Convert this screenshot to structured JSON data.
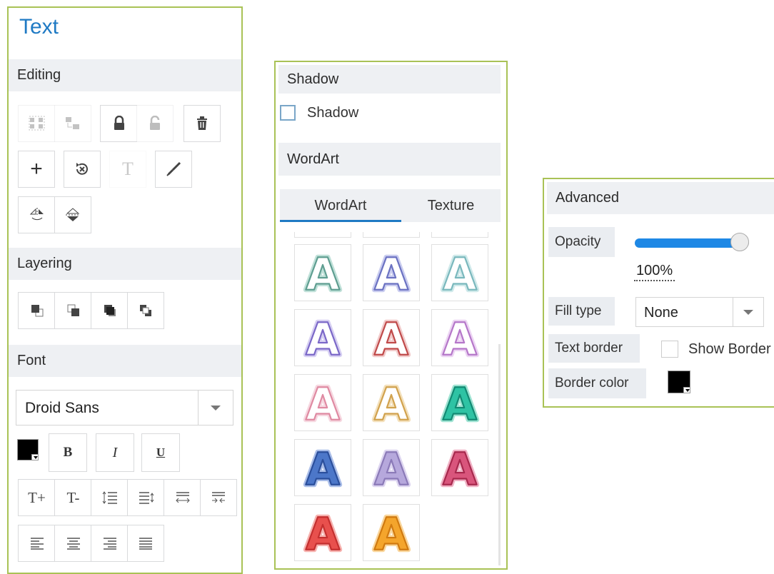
{
  "text_panel": {
    "title": "Text",
    "editing_label": "Editing",
    "layering_label": "Layering",
    "font_label": "Font",
    "font_family": "Droid Sans",
    "bold_label": "B",
    "italic_label": "I",
    "underline_label": "U",
    "increase_size_label": "T+",
    "decrease_size_label": "T-",
    "clear_format_glyph": "T"
  },
  "middle_panel": {
    "shadow_header": "Shadow",
    "shadow_checkbox_label": "Shadow",
    "shadow_checked": false,
    "wordart_header": "WordArt",
    "tabs": [
      {
        "label": "WordArt",
        "active": true
      },
      {
        "label": "Texture",
        "active": false
      }
    ],
    "wordart_letter": "A",
    "wordart_styles": [
      {
        "stroke": "#5f9e91",
        "fill": "#ffffff",
        "glow": "#bfe0d8"
      },
      {
        "stroke": "#6b72c2",
        "fill": "#ffffff",
        "glow": "#c9ccef"
      },
      {
        "stroke": "#7ab8bd",
        "fill": "#ffffff",
        "glow": "#cfe9ea"
      },
      {
        "stroke": "#7b68c8",
        "fill": "#ffffff",
        "glow": "#d6cff2"
      },
      {
        "stroke": "#c04a4a",
        "fill": "#ffffff",
        "glow": "#f1caca"
      },
      {
        "stroke": "#b577c9",
        "fill": "#ffffff",
        "glow": "#ecd4f3"
      },
      {
        "stroke": "#df8aa2",
        "fill": "#ffffff",
        "glow": "#f6d7e0"
      },
      {
        "stroke": "#d1a24e",
        "fill": "#ffffff",
        "glow": "#f3e0bb"
      },
      {
        "stroke": "#128a73",
        "fill": "#2ec3a4",
        "glow": "#9ee3d2"
      },
      {
        "stroke": "#2b4f9c",
        "fill": "#4c77c9",
        "glow": "#a9bde8"
      },
      {
        "stroke": "#8b7ab8",
        "fill": "#b6a8dc",
        "glow": "#ddd5f0"
      },
      {
        "stroke": "#a8284d",
        "fill": "#d9557c",
        "glow": "#f0b1c4"
      },
      {
        "stroke": "#c42f2f",
        "fill": "#e8504d",
        "glow": "#f6b1ae"
      },
      {
        "stroke": "#d07a10",
        "fill": "#f4a52c",
        "glow": "#f9d59a"
      }
    ]
  },
  "advanced_panel": {
    "header": "Advanced",
    "opacity_label": "Opacity",
    "opacity_value": "100%",
    "opacity_fraction": 1.0,
    "fill_type_label": "Fill type",
    "fill_type_value": "None",
    "text_border_label": "Text border",
    "show_border_label": "Show Border",
    "show_border_checked": false,
    "border_color_label": "Border color",
    "border_color": "#000000"
  },
  "colors": {
    "accent_blue": "#1f7ac4",
    "panel_border": "#a9c256",
    "section_bg": "#eef0f3",
    "slider_fill": "#1e88e5"
  }
}
